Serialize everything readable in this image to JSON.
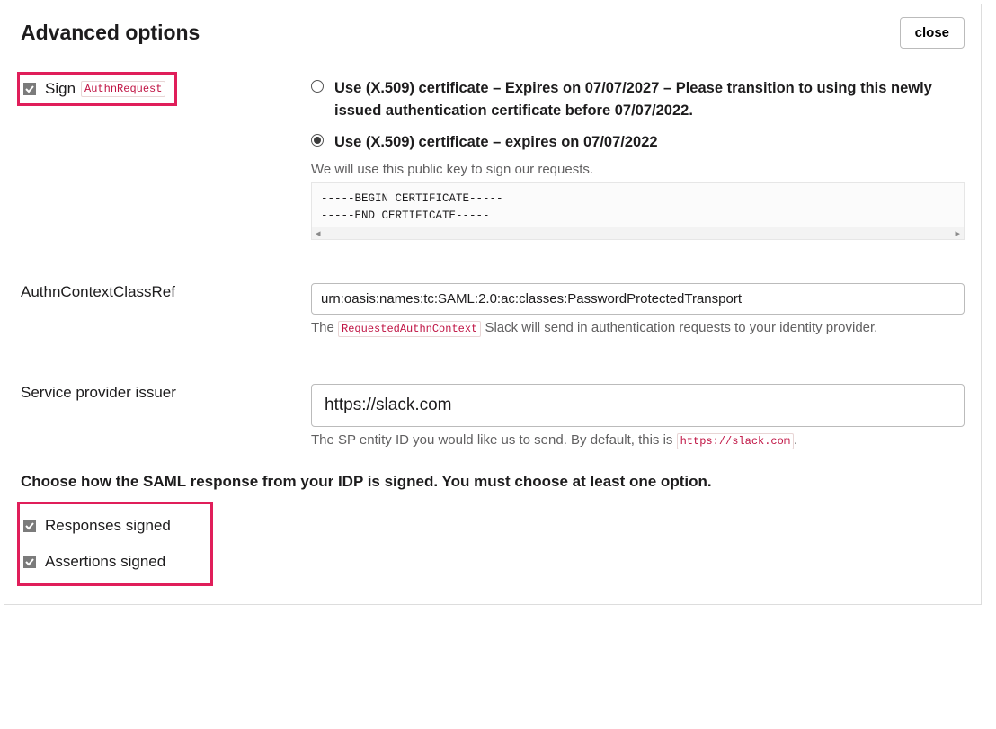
{
  "header": {
    "title": "Advanced options",
    "close_label": "close"
  },
  "sign_request": {
    "label_prefix": "Sign",
    "code_label": "AuthnRequest",
    "checked": true,
    "radios": [
      {
        "label": "Use (X.509) certificate – Expires on 07/07/2027 – Please transition to using this newly issued authentication certificate before 07/07/2022.",
        "selected": false
      },
      {
        "label": "Use (X.509) certificate – expires on 07/07/2022",
        "selected": true
      }
    ],
    "help": "We will use this public key to sign our requests.",
    "cert_begin": "-----BEGIN CERTIFICATE-----",
    "cert_end": "-----END CERTIFICATE-----"
  },
  "authn_context": {
    "label": "AuthnContextClassRef",
    "value": "urn:oasis:names:tc:SAML:2.0:ac:classes:PasswordProtectedTransport",
    "help_prefix": "The",
    "help_code": "RequestedAuthnContext",
    "help_suffix": "Slack will send in authentication requests to your identity provider."
  },
  "sp_issuer": {
    "label": "Service provider issuer",
    "value": "https://slack.com",
    "help_prefix": "The SP entity ID you would like us to send. By default, this is",
    "help_code": "https://slack.com",
    "help_suffix": "."
  },
  "signing_instruction": "Choose how the SAML response from your IDP is signed. You must choose at least one option.",
  "responses_signed": {
    "label": "Responses signed",
    "checked": true
  },
  "assertions_signed": {
    "label": "Assertions signed",
    "checked": true
  }
}
